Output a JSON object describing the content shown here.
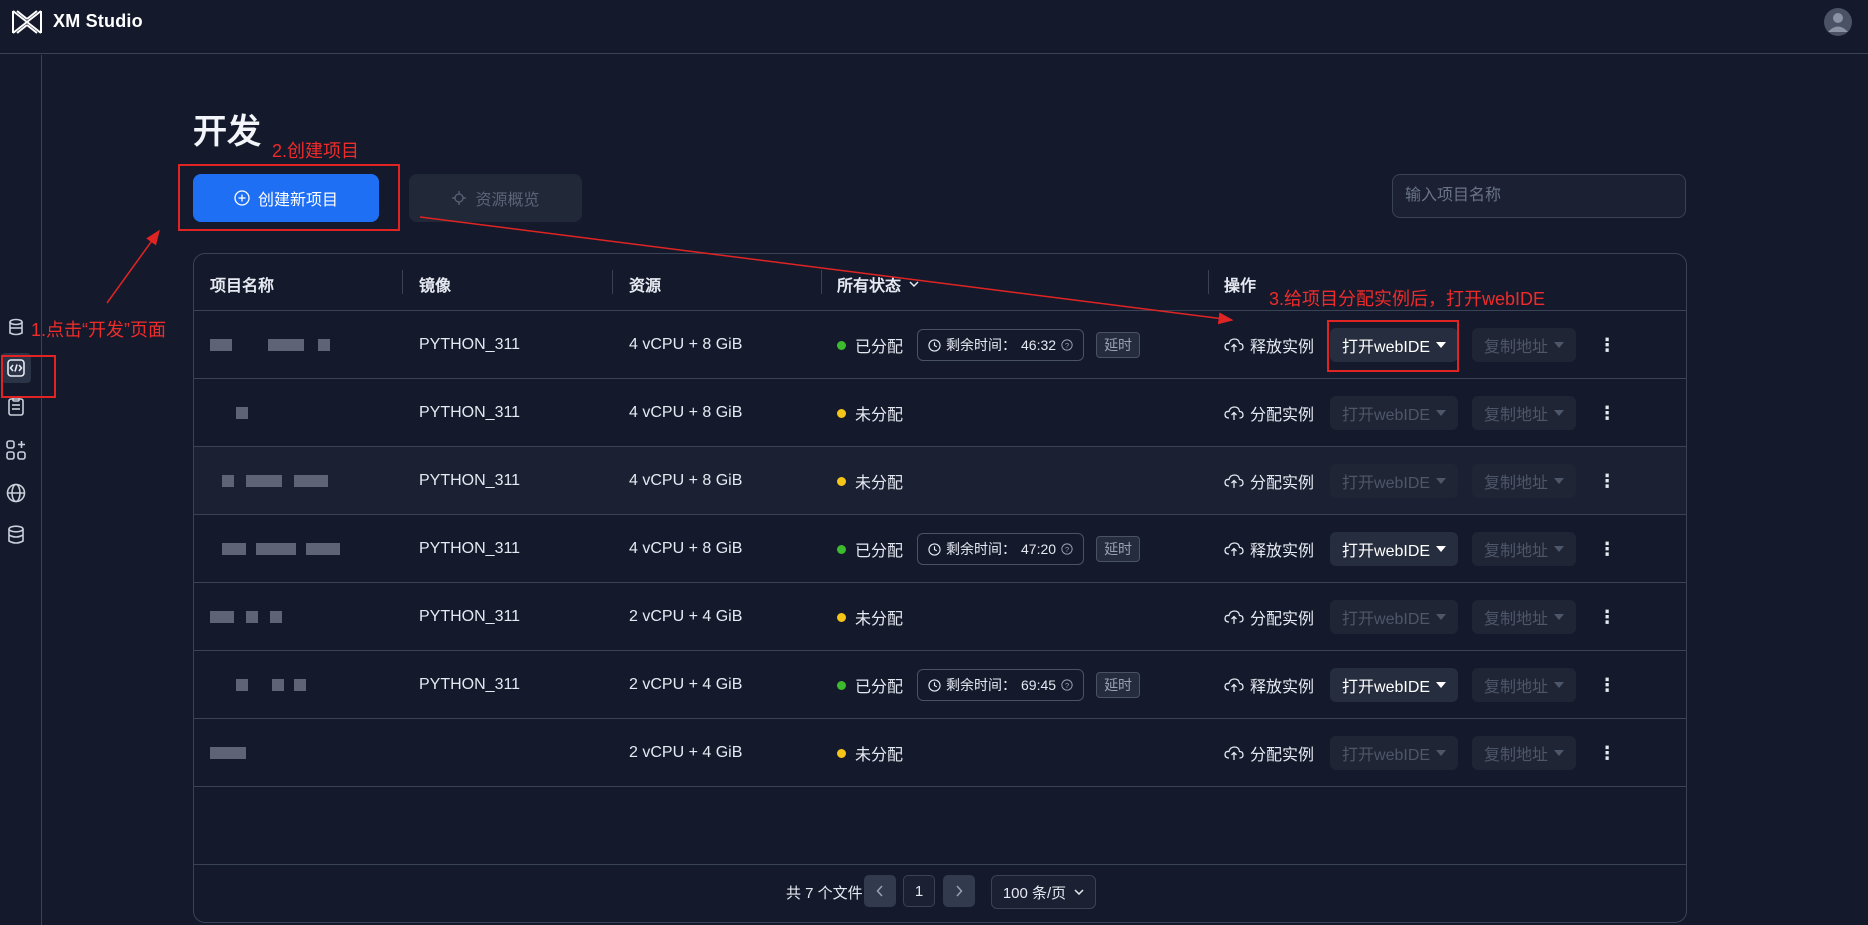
{
  "app": {
    "brand": "XM Studio"
  },
  "page": {
    "title": "开发"
  },
  "toolbar": {
    "create_label": "创建新项目",
    "overview_label": "资源概览",
    "search_placeholder": "输入项目名称"
  },
  "annotations": {
    "step1": "1.点击“开发”页面",
    "step2": "2.创建项目",
    "step3": "3.给项目分配实例后，打开webIDE"
  },
  "table": {
    "headers": {
      "name": "项目名称",
      "image": "镜像",
      "resource": "资源",
      "status": "所有状态",
      "ops": "操作"
    },
    "rows": [
      {
        "image": "PYTHON_311",
        "resource": "4 vCPU + 8 GiB",
        "status": "已分配",
        "status_color": "#3dbb2e",
        "timer_label": "剩余时间：",
        "timer": "46:32",
        "delay": "延时",
        "action": "释放实例",
        "ide": "打开webIDE",
        "copy": "复制地址",
        "ide_enabled": true
      },
      {
        "image": "PYTHON_311",
        "resource": "4 vCPU + 8 GiB",
        "status": "未分配",
        "status_color": "#f5c518",
        "action": "分配实例",
        "ide": "打开webIDE",
        "copy": "复制地址",
        "ide_enabled": false
      },
      {
        "image": "PYTHON_311",
        "resource": "4 vCPU + 8 GiB",
        "status": "未分配",
        "status_color": "#f5c518",
        "action": "分配实例",
        "ide": "打开webIDE",
        "copy": "复制地址",
        "ide_enabled": false
      },
      {
        "image": "PYTHON_311",
        "resource": "4 vCPU + 8 GiB",
        "status": "已分配",
        "status_color": "#3dbb2e",
        "timer_label": "剩余时间：",
        "timer": "47:20",
        "delay": "延时",
        "action": "释放实例",
        "ide": "打开webIDE",
        "copy": "复制地址",
        "ide_enabled": true
      },
      {
        "image": "PYTHON_311",
        "resource": "2 vCPU + 4 GiB",
        "status": "未分配",
        "status_color": "#f5c518",
        "action": "分配实例",
        "ide": "打开webIDE",
        "copy": "复制地址",
        "ide_enabled": false
      },
      {
        "image": "PYTHON_311",
        "resource": "2 vCPU + 4 GiB",
        "status": "已分配",
        "status_color": "#3dbb2e",
        "timer_label": "剩余时间：",
        "timer": "69:45",
        "delay": "延时",
        "action": "释放实例",
        "ide": "打开webIDE",
        "copy": "复制地址",
        "ide_enabled": true
      },
      {
        "image": "",
        "resource": "2 vCPU + 4 GiB",
        "status": "未分配",
        "status_color": "#f5c518",
        "action": "分配实例",
        "ide": "打开webIDE",
        "copy": "复制地址",
        "ide_enabled": false
      }
    ]
  },
  "pagination": {
    "total": "共 7 个文件",
    "current_page": "1",
    "page_size": "100 条/页"
  },
  "icons": {
    "sidebar": [
      "cylinder-icon",
      "code-icon",
      "clipboard-icon",
      "apps-add-icon",
      "globe-icon",
      "database-icon"
    ],
    "action_release": "cloud-upload-icon",
    "action_assign": "cloud-upload-icon",
    "more": "more-vertical-icon"
  }
}
